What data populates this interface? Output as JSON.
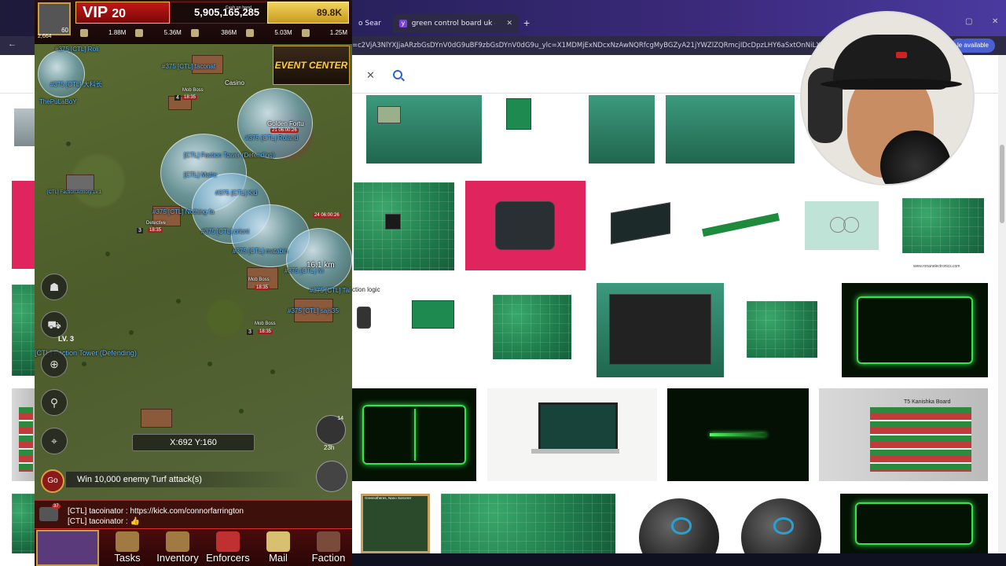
{
  "browser": {
    "tabs": [
      {
        "label": "o Sear",
        "active": false
      },
      {
        "label": "green control board uk - Yahoo",
        "active": true
      }
    ],
    "new_tab_icon": "plus-icon",
    "url": "=c2VjA3NlYXJjaARzbGsDYnV0dG9uBF9zbGsDYnV0dG9u_ylc=X1MDMjExNDcxNzAwNQRfcgMyBGZyA21jYWZlZQRmcjIDcDpzLHY6aSxtOnNiLXRvcARncHJpZANqS...",
    "url_display": "=c2VjA3NlYXJjaARzbGsDYnV0dG9uBF9zbGsDYnV0dG9u_ylc=X1MDMjExNDcxNzAwNQRfcgMyBGZyA21jYWZlZQRmcjIDcDpzLHY6aSxtOnNiLXRvcARncHJpZANqS",
    "update_badge": "le available"
  },
  "search": {
    "clear_icon": "close-icon",
    "search_icon": "search-icon"
  },
  "results": {
    "row3_caption": "ction logic",
    "row2_watermark": "www.ronanelectronics.com",
    "row4_label": "T5 Kanishka Board",
    "row5_card_title": "Greenotheres, Nano Sorcerer"
  },
  "game": {
    "player_level": "60",
    "player_power": "2,664",
    "vip_label": "VIP",
    "vip_level": "20",
    "cash_label": "Cash on hand",
    "cash": "5,905,165,285",
    "gold": "89.8K",
    "resources": [
      "1.88M",
      "5.36M",
      "386M",
      "5.03M",
      "1.25M"
    ],
    "event_center": "EVENT CENTER",
    "map_labels": [
      "#375 [CTL] Roli",
      "#375 [CTL] taconat",
      "Casino",
      "#375 [CTL] 大科长",
      "ThePuLaBoY",
      "Mob Boss",
      "Golden Fortu",
      "#375 [CTL] Roland",
      "[CTL] Faction Tower (Defending)",
      "[CTL] Faction Armory Lv.1",
      "[CTL] Matte",
      "#375 [CTL] Kid",
      "Detective",
      "#375 [CTL] Nothing fa",
      "#375 [CTL] cricnt",
      "#375 [CTL] matabin",
      "#375 [CTL] Ivi",
      "Mob Boss",
      "#375 [CTL] Tal",
      "#375 [CTL] sajs35",
      "Mob Boss",
      "[CTL] Faction Tower (Defending)"
    ],
    "timers": [
      "18:35",
      "21 06:00:26",
      "18:35",
      "18:35",
      "18:35",
      "24 06:00:26"
    ],
    "levels": [
      "4",
      "3",
      "3"
    ],
    "distance": "16.1 km",
    "lv_badge": "LV. 3",
    "coords": "X:692 Y:160",
    "timer_count": "14",
    "timer_time": "23h",
    "go_label": "Go",
    "quest": "Win 10,000 enemy Turf attack(s)",
    "chat": {
      "badge": "37",
      "lines": [
        "[CTL] tacoinator : https://kick.com/connorfarrington",
        "[CTL] tacoinator : 👍"
      ]
    },
    "nav": [
      "Tasks",
      "Inventory",
      "Enforcers",
      "Mail",
      "Faction"
    ]
  }
}
